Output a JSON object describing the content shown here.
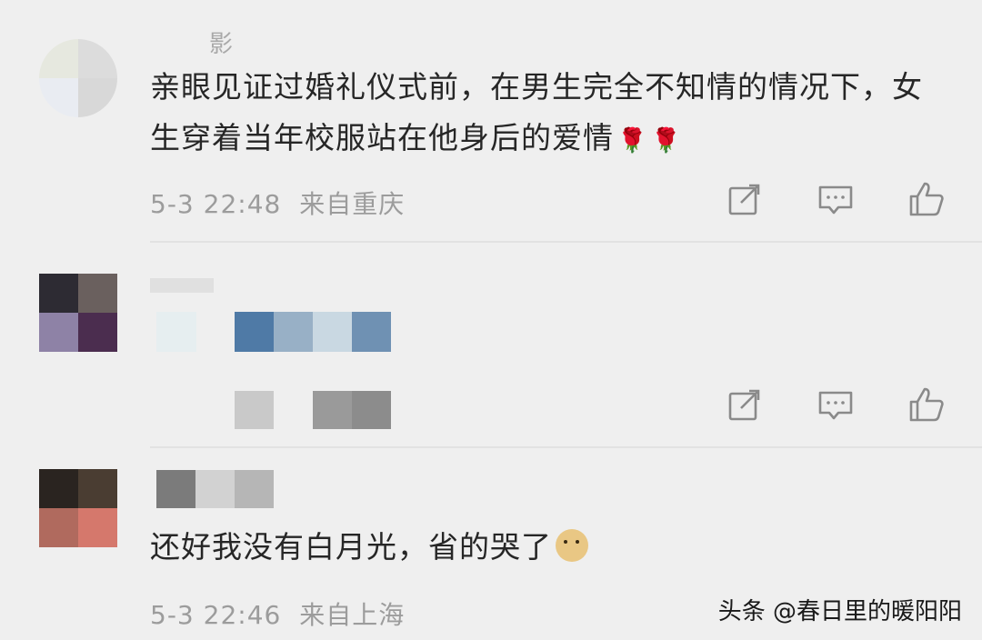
{
  "comments": [
    {
      "username": "影",
      "text": "亲眼见证过婚礼仪式前，在男生完全不知情的情况下，女生穿着当年校服站在他身后的爱情",
      "emojis": [
        "🌹",
        "🌹"
      ],
      "time": "5-3 22:48",
      "location": "来自重庆"
    },
    {
      "username": "",
      "text": "",
      "time": "",
      "location": ""
    },
    {
      "username": "",
      "text": "还好我没有白月光，省的哭了",
      "emoji_name": "doge",
      "time": "5-3 22:46",
      "location": "来自上海"
    }
  ],
  "icons": {
    "share": "share-icon",
    "reply": "comment-icon",
    "like": "thumbs-up-icon"
  },
  "watermark": "头条 @春日里的暖阳阳",
  "colors": {
    "background": "#efefef",
    "text": "#262626",
    "meta": "#9c9c9c",
    "rose": "#c8102e"
  }
}
